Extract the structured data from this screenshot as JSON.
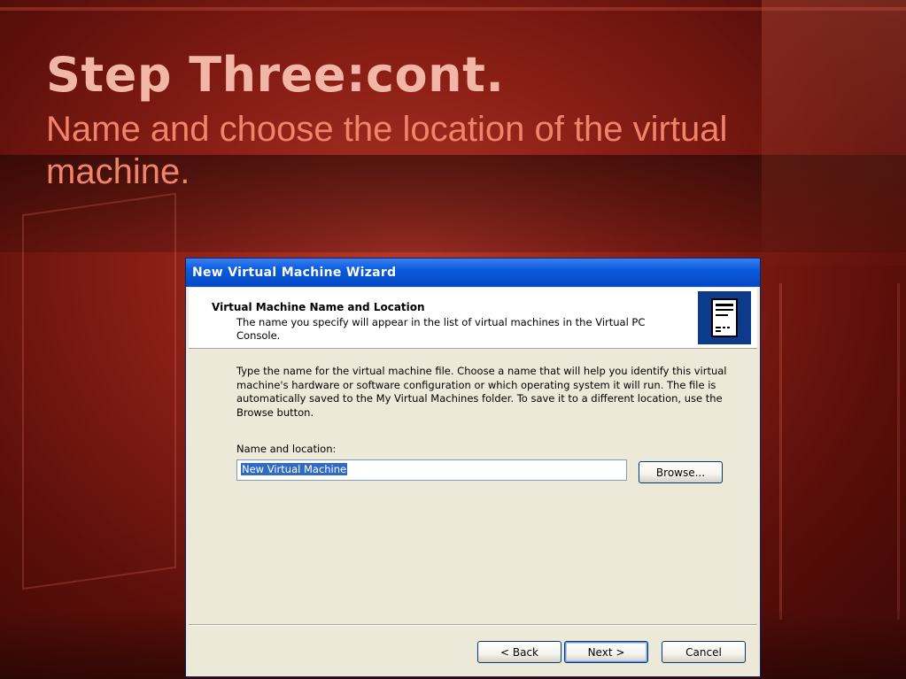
{
  "slide": {
    "title": "Step Three:cont.",
    "subtitle": "Name and choose the location of the virtual machine."
  },
  "window": {
    "title": "New Virtual Machine Wizard",
    "header_title": "Virtual Machine Name and Location",
    "header_description": "The name you specify will appear in the list of virtual machines in the Virtual PC Console.",
    "header_icon": "computer-tower-icon",
    "body_text": "Type the name for the virtual machine file. Choose a name that will help you identify this virtual machine's hardware or software configuration or which operating system it will run. The file is automatically saved to the My Virtual Machines folder. To save it to a different location, use the Browse button.",
    "name_label": "Name and location:",
    "name_value": "New Virtual Machine",
    "browse_label": "Browse...",
    "back_label": "< Back",
    "next_label": "Next >",
    "cancel_label": "Cancel"
  },
  "colors": {
    "titlebar": "#0a5bdc",
    "slide_title": "#f2b6a6",
    "slide_subtitle": "#f0846a",
    "selection": "#316ac5"
  }
}
